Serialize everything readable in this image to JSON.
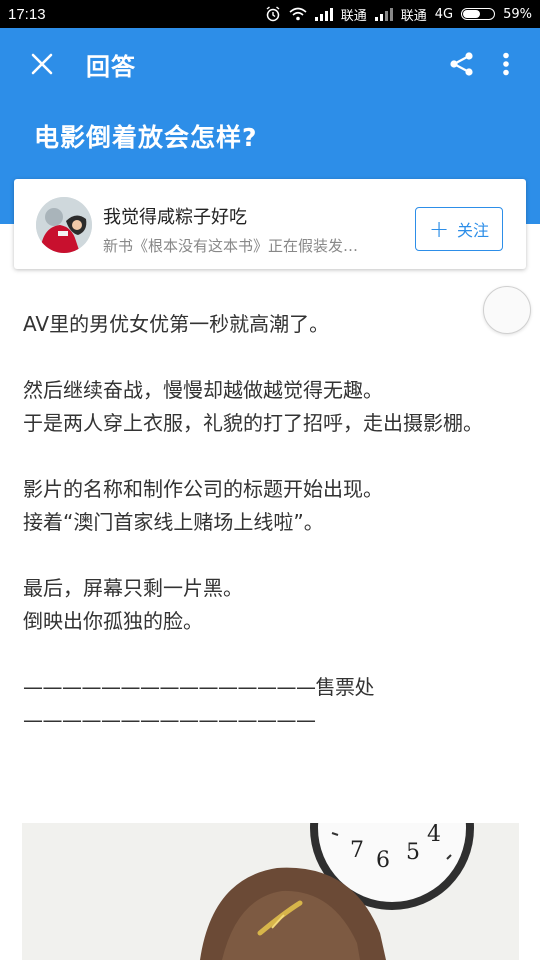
{
  "status_bar": {
    "time": "17:13",
    "carrier1": "联通",
    "carrier2": "联通",
    "network": "4G",
    "battery_text": "59%",
    "battery_level": 0.59,
    "icons": [
      "alarm-icon",
      "wifi-icon",
      "signal-icon",
      "signal-icon",
      "battery-icon"
    ]
  },
  "header": {
    "close_icon": "close-icon",
    "title": "回答",
    "share_icon": "share-icon",
    "more_icon": "more-vertical-icon",
    "question": "电影倒着放会怎样?",
    "color": "#2d8ee8"
  },
  "author": {
    "name": "我觉得咸粽子好吃",
    "bio": "新书《根本没有这本书》正在假装发…",
    "follow_label": "关注"
  },
  "answer": {
    "paragraphs": [
      "AV里的男优女优第一秒就高潮了。",
      "然后继续奋战，慢慢却越做越觉得无趣。\n于是两人穿上衣服，礼貌的打了招呼，走出摄影棚。",
      "影片的名称和制作公司的标题开始出现。\n接着“澳门首家线上赌场上线啦”。",
      "最后，屏幕只剩一片黑。\n倒映出你孤独的脸。",
      "———————————————售票处\n———————————————"
    ],
    "clock_digits": [
      "7",
      "6",
      "5",
      "4"
    ]
  }
}
